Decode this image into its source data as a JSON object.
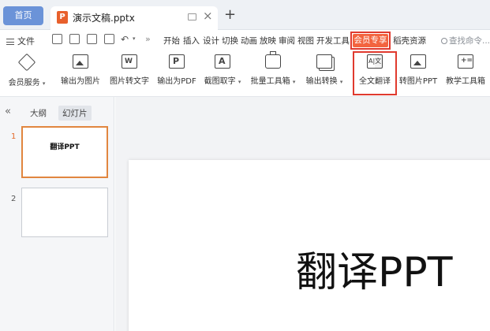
{
  "tabbar": {
    "home_label": "首页",
    "doc_logo": "P",
    "doc_title": "演示文稿.pptx",
    "close_glyph": "×",
    "add_glyph": "+"
  },
  "menubar": {
    "file_label": "文件",
    "more_glyph": "»",
    "items": [
      "开始",
      "插入",
      "设计",
      "切换",
      "动画",
      "放映",
      "审阅",
      "视图",
      "开发工具"
    ],
    "member_label": "会员专享",
    "shell_label": "稻壳资源",
    "search_placeholder": "查找命令..."
  },
  "ribbon": {
    "member_service": "会员服务",
    "to_image": "输出为图片",
    "image_to_text": "图片转文字",
    "to_pdf": "输出为PDF",
    "screenshot_text": "截图取字",
    "batch_tools": "批量工具箱",
    "convert": "输出转换",
    "full_translate": "全文翻译",
    "to_image_ppt": "转图片PPT",
    "teaching_tools": "教学工具箱"
  },
  "leftpanel": {
    "collapse_glyph": "«",
    "outline_tab": "大纲",
    "slides_tab": "幻灯片",
    "slides": [
      {
        "num": "1",
        "title": "翻译PPT"
      },
      {
        "num": "2",
        "title": ""
      }
    ]
  },
  "editor": {
    "slide_title": "翻译PPT"
  },
  "colors": {
    "accent_orange": "#f3643f",
    "highlight_red": "#e03a2e",
    "home_blue": "#6b93d8"
  }
}
